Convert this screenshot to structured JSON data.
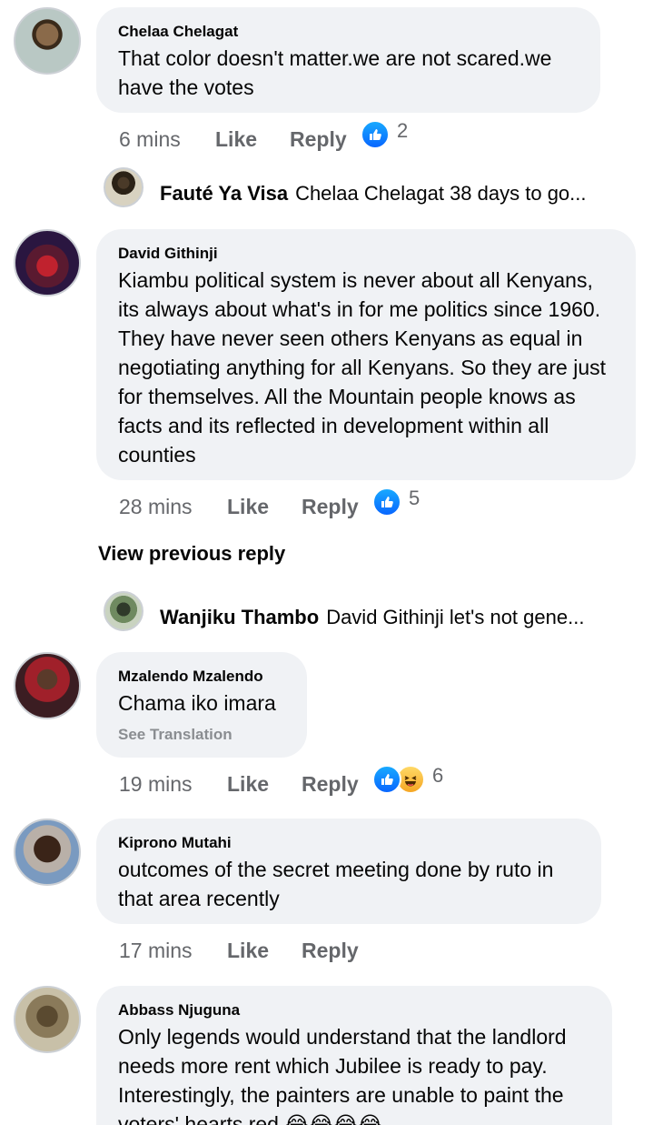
{
  "comments": [
    {
      "author": "Chelaa Chelagat",
      "text": "That color doesn't matter.we are not scared.we have the votes",
      "time": "6 mins",
      "like_label": "Like",
      "reply_label": "Reply",
      "reaction_count": "2"
    },
    {
      "author": "David Githinji",
      "text": "Kiambu political system is never about all Kenyans,  its always about what's in for me politics since 1960. They have never seen others Kenyans as equal in negotiating anything for all Kenyans.  So they are just for themselves.  All the Mountain people knows as facts and its reflected in development within all counties",
      "time": "28 mins",
      "like_label": "Like",
      "reply_label": "Reply",
      "reaction_count": "5"
    },
    {
      "author": "Mzalendo Mzalendo",
      "text": "Chama iko imara",
      "see_translation": "See Translation",
      "time": "19 mins",
      "like_label": "Like",
      "reply_label": "Reply",
      "reaction_count": "6"
    },
    {
      "author": "Kiprono Mutahi",
      "text": "outcomes of the secret meeting done by ruto in that area recently",
      "time": "17 mins",
      "like_label": "Like",
      "reply_label": "Reply"
    },
    {
      "author": "Abbass Njuguna",
      "text": "Only legends would understand that the landlord needs more rent which Jubilee is ready to pay. Interestingly, the painters are unable to paint the voters' hearts red 😂😂😂😂"
    }
  ],
  "replies": [
    {
      "author": "Fauté Ya Visa",
      "snippet": "Chelaa Chelagat 38 days to go..."
    },
    {
      "author": "Wanjiku Thambo",
      "snippet": "David Githinji let's not gene..."
    }
  ],
  "view_previous_reply": "View previous reply",
  "colors": {
    "bubble": "#f0f2f5",
    "meta": "#65676b",
    "like_blue": "#0866ff"
  }
}
